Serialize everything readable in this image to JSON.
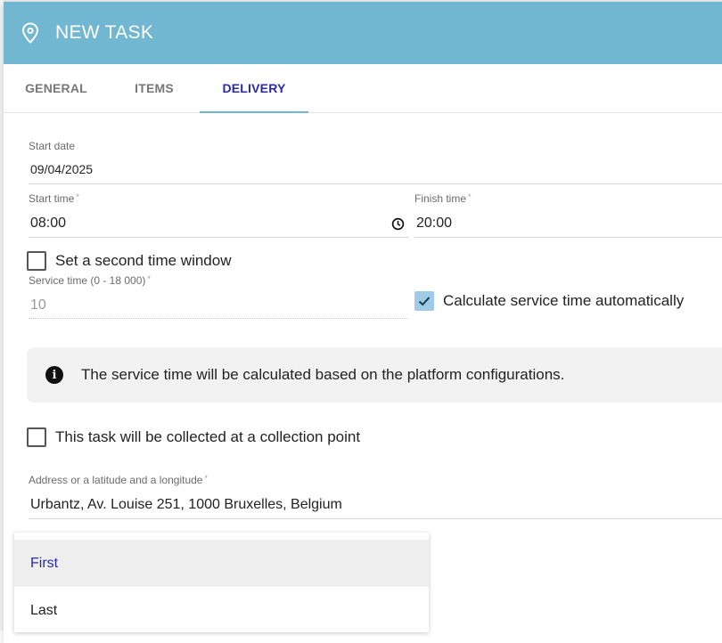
{
  "dialog": {
    "title": "NEW TASK",
    "header_color": "#72b7d1"
  },
  "tabs": [
    {
      "label": "GENERAL",
      "active": false
    },
    {
      "label": "ITEMS",
      "active": false
    },
    {
      "label": "DELIVERY",
      "active": true
    }
  ],
  "form": {
    "start_date": {
      "label": "Start date",
      "value": "09/04/2025"
    },
    "start_time": {
      "label": "Start time",
      "required_mark": "*",
      "value": "08:00"
    },
    "finish_time": {
      "label": "Finish time",
      "required_mark": "*",
      "value": "20:00"
    },
    "second_window": {
      "label": "Set a second time window",
      "checked": false
    },
    "service_time": {
      "label": "Service time (0 - 18 000)",
      "required_mark": "*",
      "value": "10"
    },
    "auto_service": {
      "label": "Calculate service time automatically",
      "checked": true
    },
    "info_message": "The service time will be calculated based on the platform configurations.",
    "collection_point": {
      "label": "This task will be collected at a collection point",
      "checked": false
    },
    "address": {
      "label": "Address or a latitude and a longitude",
      "required_mark": "*",
      "value": "Urbantz, Av. Louise 251, 1000 Bruxelles, Belgium"
    }
  },
  "dropdown": {
    "options": [
      {
        "label": "First",
        "highlighted": true
      },
      {
        "label": "Last",
        "highlighted": false
      }
    ]
  },
  "colors": {
    "accent": "#72b7d1",
    "active_tab_text": "#2a2aa8",
    "checkbox_checked": "#9fcbe6"
  }
}
